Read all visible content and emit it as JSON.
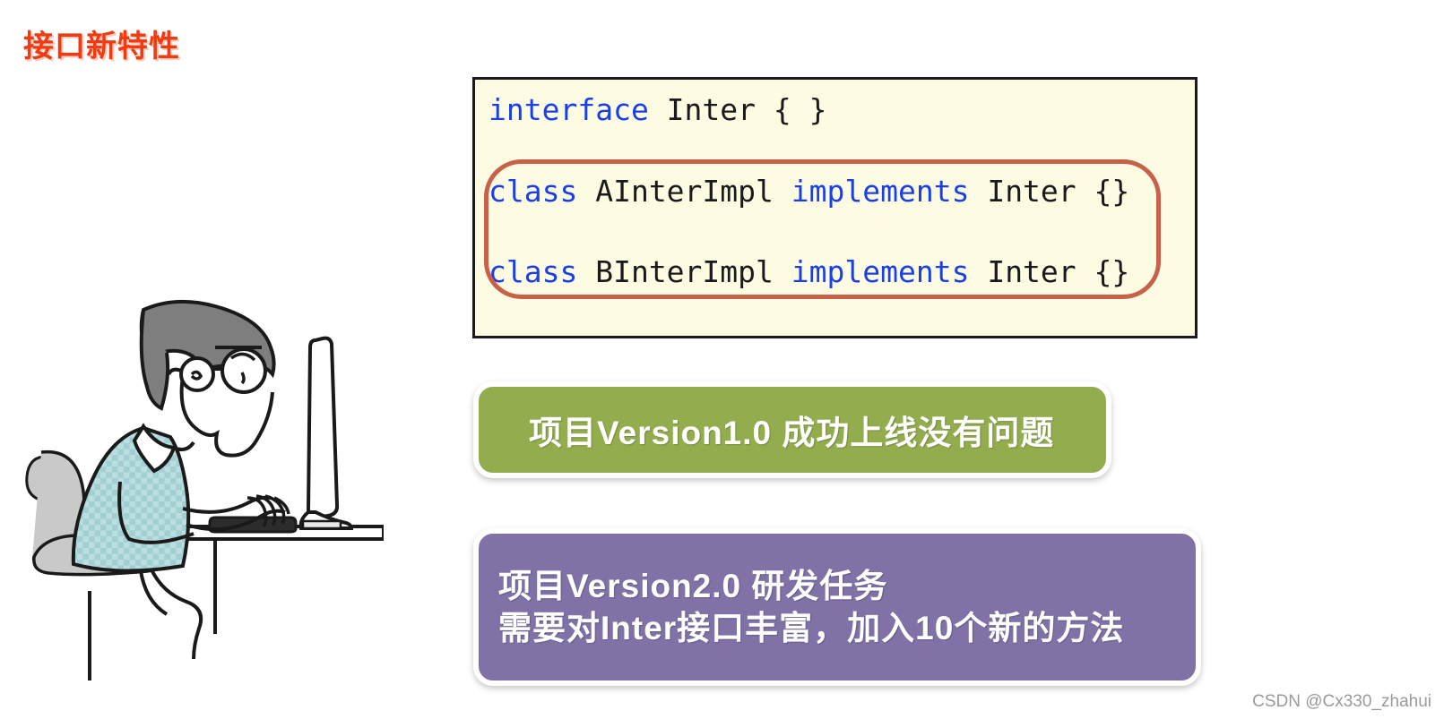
{
  "slide": {
    "title": "接口新特性",
    "title_color": "#EE3B14",
    "background_color": "#FFFFFF"
  },
  "illustration": {
    "name": "programmer-at-desk-illustration",
    "description": "卡通程序员戴眼镜坐在办公椅上使用台式电脑",
    "colors": {
      "hair": "#7E7E7E",
      "shirt": "#A9D7DA",
      "chair": "#C9C9C9",
      "outline": "#1a1a1a",
      "skin": "#FFFFFF"
    }
  },
  "code_panel": {
    "background_color": "#FEFBE3",
    "border_color": "#1A1A1A",
    "keyword_color": "#1A3FE8",
    "text_color": "#1A1A1A",
    "highlight_border_color": "#C8614A",
    "lines": [
      {
        "id": "interface-line",
        "segments": [
          {
            "text": "interface",
            "kind": "keyword"
          },
          {
            "text": " Inter { }",
            "kind": "plain"
          }
        ]
      },
      {
        "id": "class-a-line",
        "segments": [
          {
            "text": "class",
            "kind": "keyword"
          },
          {
            "text": " AInterImpl ",
            "kind": "plain"
          },
          {
            "text": "implements",
            "kind": "keyword"
          },
          {
            "text": " Inter {}",
            "kind": "plain"
          }
        ]
      },
      {
        "id": "class-b-line",
        "segments": [
          {
            "text": "class",
            "kind": "keyword"
          },
          {
            "text": " BInterImpl ",
            "kind": "plain"
          },
          {
            "text": "implements",
            "kind": "keyword"
          },
          {
            "text": " Inter {}",
            "kind": "plain"
          }
        ]
      }
    ]
  },
  "callouts": {
    "green": {
      "color": "#93AC4E",
      "lines": [
        "项目Version1.0  成功上线没有问题"
      ]
    },
    "purple": {
      "color": "#8071A6",
      "lines": [
        "项目Version2.0  研发任务",
        "需要对Inter接口丰富，加入10个新的方法"
      ]
    }
  },
  "watermark": {
    "text": "CSDN @Cx330_zhahui"
  }
}
